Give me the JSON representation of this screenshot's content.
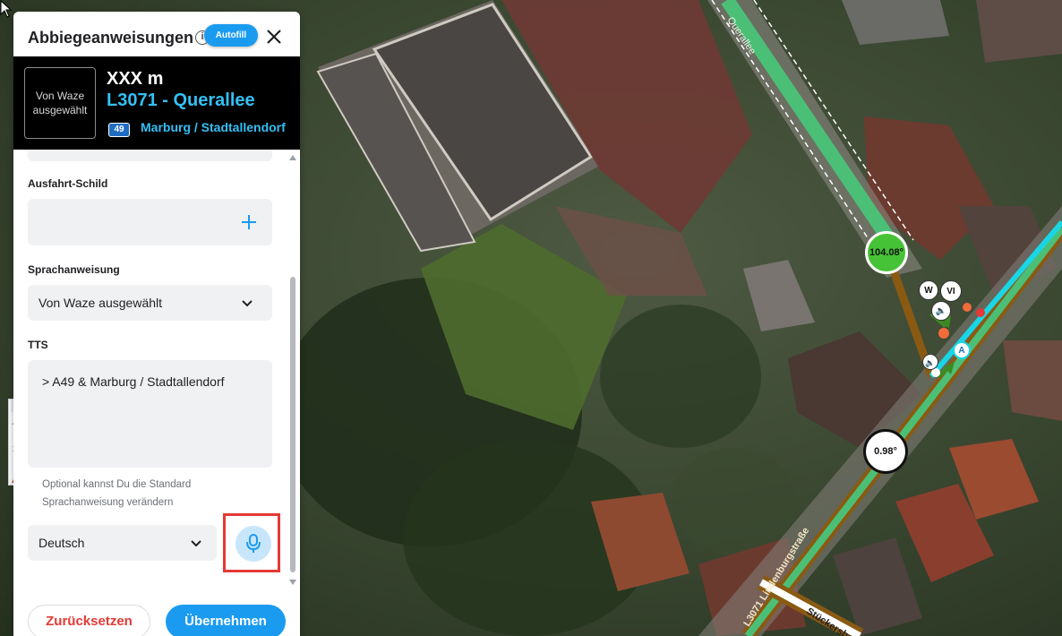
{
  "panel": {
    "title": "Abbiegeanweisungen",
    "info_glyph": "i",
    "autofill_label": "Autofill",
    "close_icon": "close-icon"
  },
  "preview": {
    "placeholder": "Von Waze ausgewählt",
    "distance": "XXX m",
    "street": "L3071 - Querallee",
    "shield_number": "49",
    "towards": "Marburg / Stadtallendorf"
  },
  "form": {
    "exit_sign_label": "Ausfahrt-Schild",
    "voice_label": "Sprachanweisung",
    "voice_value": "Von Waze ausgewählt",
    "tts_label": "TTS",
    "tts_value": "> A49 & Marburg / Stadtallendorf",
    "tts_helper": "Optional kannst Du die Standard Sprachanweisung verändern",
    "language_value": "Deutsch"
  },
  "footer": {
    "reset_label": "Zurücksetzen",
    "apply_label": "Übernehmen"
  },
  "map": {
    "angle_top": "104.08°",
    "angle_bottom": "0.98°",
    "node_a": "A",
    "node_w": "W",
    "node_vi": "VI",
    "street_label_main": "Querallee",
    "street_label_lower": "Stückersbach",
    "street_label_side": "L3071 Lindenburgstraße"
  },
  "colors": {
    "accent": "#1a9bf0",
    "preview_text": "#33c0f5",
    "reset_text": "#e53935",
    "highlight": "#e53935",
    "segment_green": "#4cbf77",
    "segment_cyan": "#19d6e6",
    "segment_brown": "#8a5a12"
  }
}
